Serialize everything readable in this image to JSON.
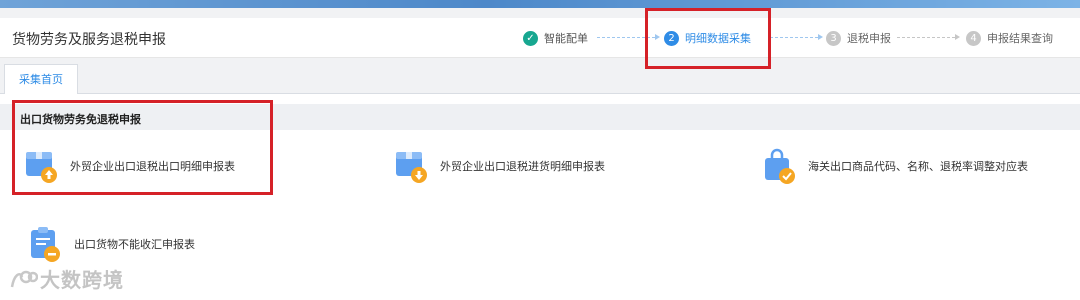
{
  "header": {
    "title": "货物劳务及服务退税申报",
    "steps": [
      {
        "index": "✓",
        "label": "智能配单",
        "state": "done"
      },
      {
        "index": "2",
        "label": "明细数据采集",
        "state": "active"
      },
      {
        "index": "3",
        "label": "退税申报",
        "state": "todo"
      },
      {
        "index": "4",
        "label": "申报结果查询",
        "state": "todo"
      }
    ]
  },
  "tabs": [
    {
      "label": "采集首页"
    }
  ],
  "section": {
    "title": "出口货物劳务免退税申报",
    "items": [
      {
        "label": "外贸企业出口退税出口明细申报表",
        "icon": "box-upload-icon"
      },
      {
        "label": "外贸企业出口退税进货明细申报表",
        "icon": "box-download-icon"
      },
      {
        "label": "海关出口商品代码、名称、退税率调整对应表",
        "icon": "shopping-bag-check-icon"
      },
      {
        "label": "出口货物不能收汇申报表",
        "icon": "clipboard-minus-icon"
      }
    ]
  },
  "watermark": {
    "text": "大数跨境"
  },
  "colors": {
    "accent": "#2f8ce6",
    "done": "#17a790",
    "highlight": "#d52128",
    "icon_blue": "#5d9ff0",
    "icon_orange": "#f5a623"
  }
}
